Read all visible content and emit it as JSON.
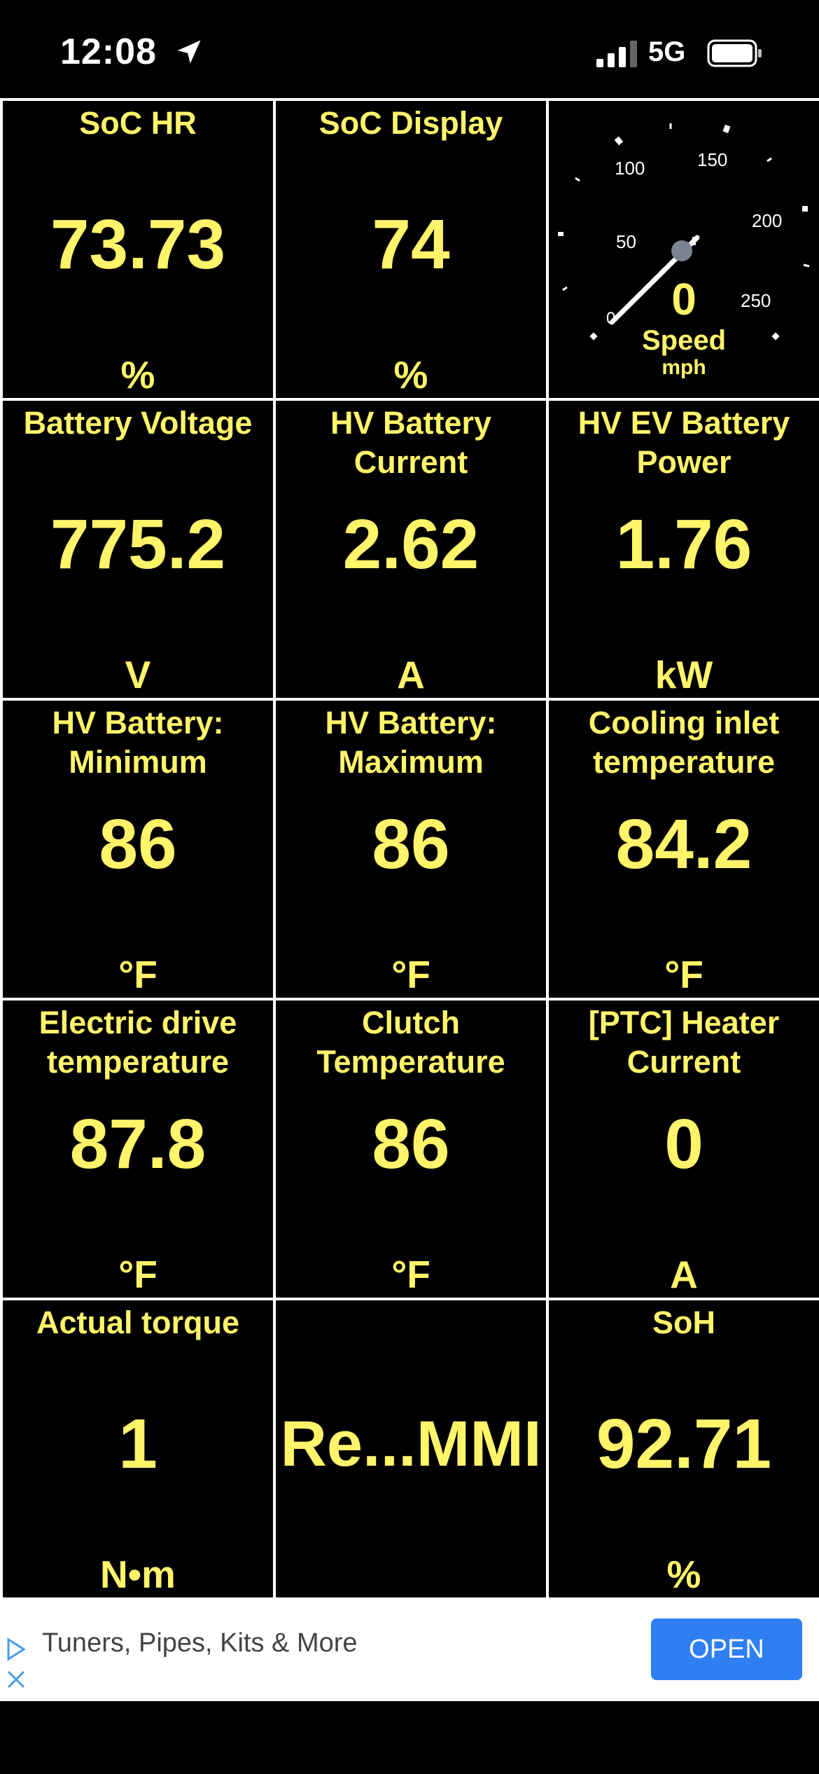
{
  "status_bar": {
    "time": "12:08",
    "network": "5G",
    "location_icon": "location-arrow-icon",
    "signal_icon": "cellular-signal-icon",
    "battery_icon": "battery-icon"
  },
  "colors": {
    "background": "#000000",
    "value_text": "#fff46a",
    "grid_lines": "#ffffff",
    "gauge_needle": "#ffffff",
    "gauge_hub": "#7a8391",
    "ad_button": "#2f7ff2"
  },
  "gauge": {
    "value": "0",
    "label": "Speed",
    "unit": "mph",
    "ticks": [
      "0",
      "50",
      "100",
      "150",
      "200",
      "250"
    ]
  },
  "tiles": [
    {
      "label": "SoC HR",
      "value": "73.73",
      "unit": "%"
    },
    {
      "label": "SoC Display",
      "value": "74",
      "unit": "%"
    },
    {
      "label": "Battery Voltage",
      "value": "775.2",
      "unit": "V"
    },
    {
      "label": "HV Battery\nCurrent",
      "value": "2.62",
      "unit": "A"
    },
    {
      "label": "HV EV Battery\nPower",
      "value": "1.76",
      "unit": "kW"
    },
    {
      "label": "HV Battery:\nMinimum",
      "value": "86",
      "unit": "°F"
    },
    {
      "label": "HV Battery:\nMaximum",
      "value": "86",
      "unit": "°F"
    },
    {
      "label": "Cooling inlet\ntemperature",
      "value": "84.2",
      "unit": "°F"
    },
    {
      "label": "Electric drive\ntemperature",
      "value": "87.8",
      "unit": "°F"
    },
    {
      "label": "Clutch\nTemperature",
      "value": "86",
      "unit": "°F"
    },
    {
      "label": "[PTC] Heater\nCurrent",
      "value": "0",
      "unit": "A"
    },
    {
      "label": "Actual torque",
      "value": "1",
      "unit": "N•m"
    },
    {
      "label": "",
      "value": "Re...MMI",
      "unit": ""
    },
    {
      "label": "SoH",
      "value": "92.71",
      "unit": "%"
    }
  ],
  "ad": {
    "text": "Tuners, Pipes, Kits & More",
    "button_label": "OPEN",
    "play_icon": "ad-choices-icon",
    "close_icon": "close-icon"
  }
}
